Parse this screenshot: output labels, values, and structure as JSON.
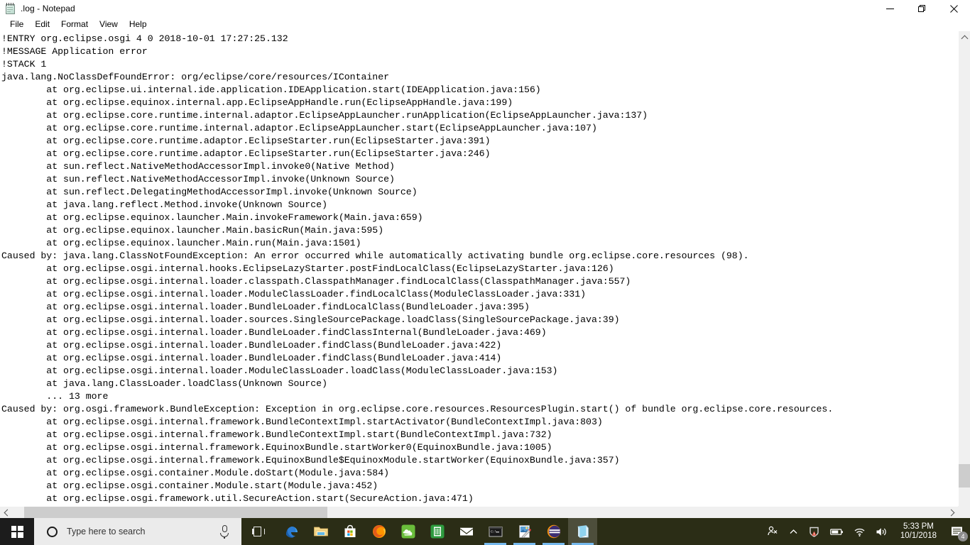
{
  "window": {
    "title": ".log - Notepad",
    "icon": "notepad-icon",
    "controls": {
      "minimize": "minimize-icon",
      "maximize": "restore-icon",
      "close": "close-icon"
    },
    "menu": [
      {
        "label": "File"
      },
      {
        "label": "Edit"
      },
      {
        "label": "Format"
      },
      {
        "label": "View"
      },
      {
        "label": "Help"
      }
    ]
  },
  "document": {
    "lines": [
      "!ENTRY org.eclipse.osgi 4 0 2018-10-01 17:27:25.132",
      "!MESSAGE Application error",
      "!STACK 1",
      "java.lang.NoClassDefFoundError: org/eclipse/core/resources/IContainer",
      "        at org.eclipse.ui.internal.ide.application.IDEApplication.start(IDEApplication.java:156)",
      "        at org.eclipse.equinox.internal.app.EclipseAppHandle.run(EclipseAppHandle.java:199)",
      "        at org.eclipse.core.runtime.internal.adaptor.EclipseAppLauncher.runApplication(EclipseAppLauncher.java:137)",
      "        at org.eclipse.core.runtime.internal.adaptor.EclipseAppLauncher.start(EclipseAppLauncher.java:107)",
      "        at org.eclipse.core.runtime.adaptor.EclipseStarter.run(EclipseStarter.java:391)",
      "        at org.eclipse.core.runtime.adaptor.EclipseStarter.run(EclipseStarter.java:246)",
      "        at sun.reflect.NativeMethodAccessorImpl.invoke0(Native Method)",
      "        at sun.reflect.NativeMethodAccessorImpl.invoke(Unknown Source)",
      "        at sun.reflect.DelegatingMethodAccessorImpl.invoke(Unknown Source)",
      "        at java.lang.reflect.Method.invoke(Unknown Source)",
      "        at org.eclipse.equinox.launcher.Main.invokeFramework(Main.java:659)",
      "        at org.eclipse.equinox.launcher.Main.basicRun(Main.java:595)",
      "        at org.eclipse.equinox.launcher.Main.run(Main.java:1501)",
      "Caused by: java.lang.ClassNotFoundException: An error occurred while automatically activating bundle org.eclipse.core.resources (98).",
      "        at org.eclipse.osgi.internal.hooks.EclipseLazyStarter.postFindLocalClass(EclipseLazyStarter.java:126)",
      "        at org.eclipse.osgi.internal.loader.classpath.ClasspathManager.findLocalClass(ClasspathManager.java:557)",
      "        at org.eclipse.osgi.internal.loader.ModuleClassLoader.findLocalClass(ModuleClassLoader.java:331)",
      "        at org.eclipse.osgi.internal.loader.BundleLoader.findLocalClass(BundleLoader.java:395)",
      "        at org.eclipse.osgi.internal.loader.sources.SingleSourcePackage.loadClass(SingleSourcePackage.java:39)",
      "        at org.eclipse.osgi.internal.loader.BundleLoader.findClassInternal(BundleLoader.java:469)",
      "        at org.eclipse.osgi.internal.loader.BundleLoader.findClass(BundleLoader.java:422)",
      "        at org.eclipse.osgi.internal.loader.BundleLoader.findClass(BundleLoader.java:414)",
      "        at org.eclipse.osgi.internal.loader.ModuleClassLoader.loadClass(ModuleClassLoader.java:153)",
      "        at java.lang.ClassLoader.loadClass(Unknown Source)",
      "        ... 13 more",
      "Caused by: org.osgi.framework.BundleException: Exception in org.eclipse.core.resources.ResourcesPlugin.start() of bundle org.eclipse.core.resources.",
      "        at org.eclipse.osgi.internal.framework.BundleContextImpl.startActivator(BundleContextImpl.java:803)",
      "        at org.eclipse.osgi.internal.framework.BundleContextImpl.start(BundleContextImpl.java:732)",
      "        at org.eclipse.osgi.internal.framework.EquinoxBundle.startWorker0(EquinoxBundle.java:1005)",
      "        at org.eclipse.osgi.internal.framework.EquinoxBundle$EquinoxModule.startWorker(EquinoxBundle.java:357)",
      "        at org.eclipse.osgi.container.Module.doStart(Module.java:584)",
      "        at org.eclipse.osgi.container.Module.start(Module.java:452)",
      "        at org.eclipse.osgi.framework.util.SecureAction.start(SecureAction.java:471)"
    ]
  },
  "scrollbars": {
    "vertical": {
      "name": "vertical-scrollbar",
      "thumb_top_pct": 91,
      "thumb_height_pct": 5
    },
    "horizontal": {
      "name": "horizontal-scrollbar",
      "thumb_left_pct": 1.3,
      "thumb_width_pct": 32.5
    }
  },
  "taskbar": {
    "start": "windows-start-icon",
    "search": {
      "placeholder": "Type here to search",
      "icon": "cortana-circle-icon",
      "mic": "microphone-icon"
    },
    "task_view": "task-view-icon",
    "apps": [
      {
        "name": "edge-icon",
        "label": "Microsoft Edge",
        "active": false,
        "running": false
      },
      {
        "name": "file-explorer-icon",
        "label": "File Explorer",
        "active": false,
        "running": false
      },
      {
        "name": "microsoft-store-icon",
        "label": "Microsoft Store",
        "active": false,
        "running": false
      },
      {
        "name": "firefox-icon",
        "label": "Firefox",
        "active": false,
        "running": false
      },
      {
        "name": "cloud-app-icon",
        "label": "Cloud App",
        "active": false,
        "running": false
      },
      {
        "name": "notes-app-icon",
        "label": "Notes",
        "active": false,
        "running": false
      },
      {
        "name": "mail-icon",
        "label": "Mail",
        "active": false,
        "running": false
      },
      {
        "name": "command-prompt-icon",
        "label": "Command Prompt",
        "active": false,
        "running": true
      },
      {
        "name": "paint-icon",
        "label": "Paint",
        "active": false,
        "running": true
      },
      {
        "name": "eclipse-icon",
        "label": "Eclipse",
        "active": false,
        "running": true
      },
      {
        "name": "notepad-icon",
        "label": "Notepad",
        "active": true,
        "running": true
      }
    ],
    "tray": {
      "people": "people-icon",
      "show_hidden": "chevron-up-icon",
      "security": "security-shield-icon",
      "battery": "battery-icon",
      "network": "wifi-icon",
      "volume": "volume-icon",
      "time": "5:33 PM",
      "date": "10/1/2018",
      "action_center": "action-center-icon",
      "notification_count": "4"
    }
  },
  "colors": {
    "taskbar_bg": "#2b2d16",
    "start_bg": "#1c1c1c",
    "search_bg": "#ebebeb",
    "accent_underline": "#76b9ed",
    "scroll_thumb": "#cdcdcd",
    "scroll_track": "#f0f0f0"
  }
}
